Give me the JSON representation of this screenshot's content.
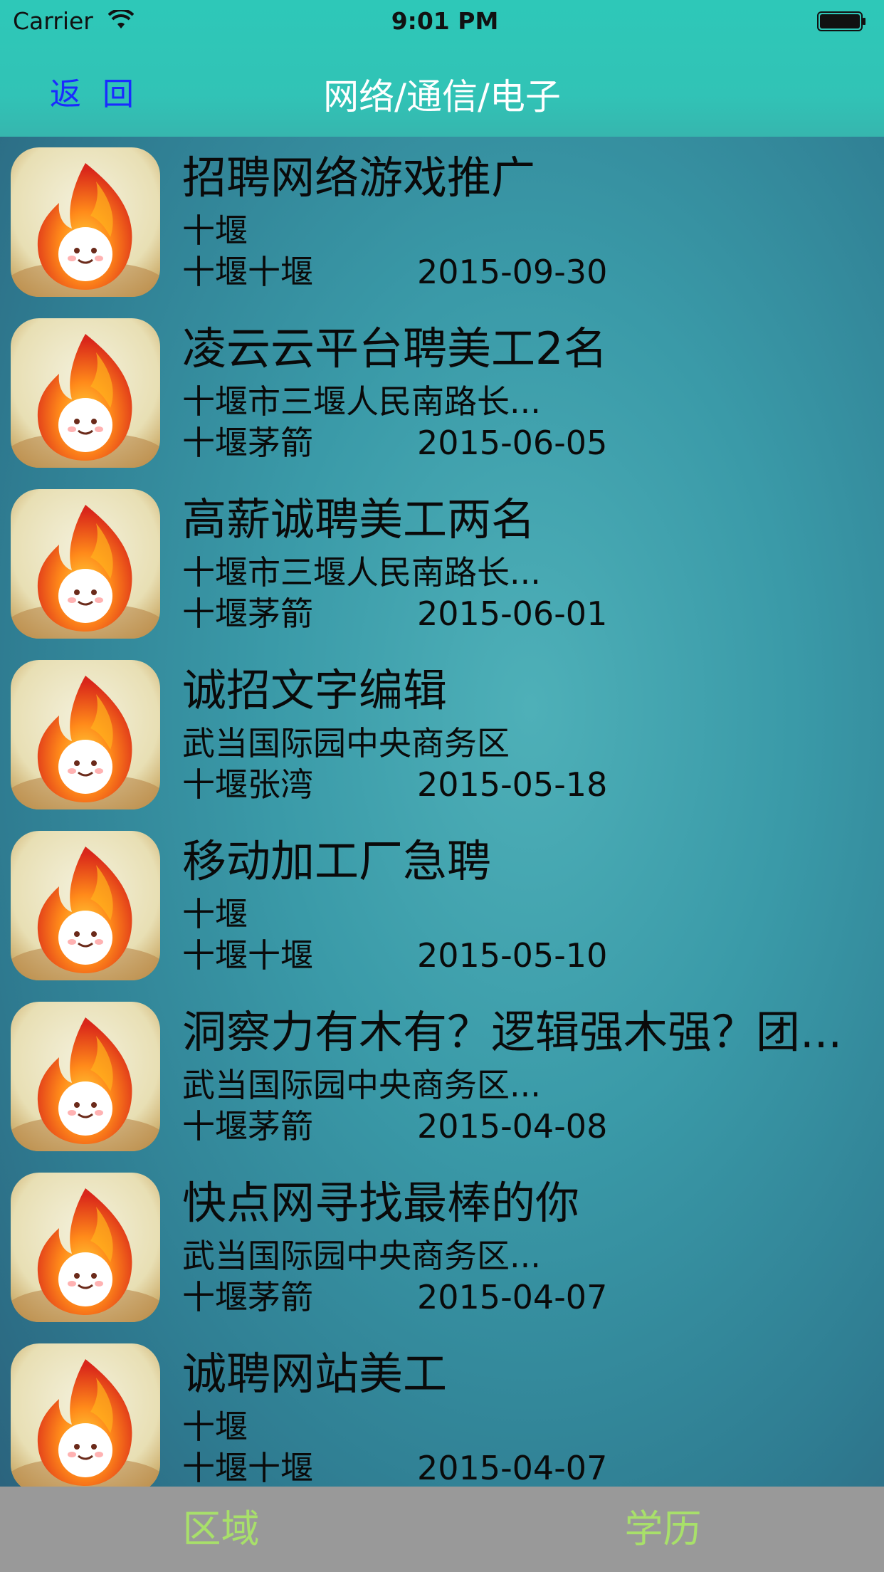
{
  "status_bar": {
    "carrier": "Carrier",
    "time": "9:01 PM"
  },
  "nav": {
    "back_label": "返 回",
    "title": "网络/通信/电子"
  },
  "jobs": [
    {
      "title": "招聘网络游戏推广",
      "address": "十堰",
      "area": "十堰十堰",
      "date": "2015-09-30"
    },
    {
      "title": "凌云云平台聘美工2名",
      "address": "十堰市三堰人民南路长...",
      "area": "十堰茅箭",
      "date": "2015-06-05"
    },
    {
      "title": "高薪诚聘美工两名",
      "address": "十堰市三堰人民南路长...",
      "area": "十堰茅箭",
      "date": "2015-06-01"
    },
    {
      "title": "诚招文字编辑",
      "address": "武当国际园中央商务区",
      "area": "十堰张湾",
      "date": "2015-05-18"
    },
    {
      "title": "移动加工厂急聘",
      "address": "十堰",
      "area": "十堰十堰",
      "date": "2015-05-10"
    },
    {
      "title": "洞察力有木有？逻辑强木强？团...",
      "address": "武当国际园中央商务区...",
      "area": "十堰茅箭",
      "date": "2015-04-08"
    },
    {
      "title": "快点网寻找最棒的你",
      "address": "武当国际园中央商务区...",
      "area": "十堰茅箭",
      "date": "2015-04-07"
    },
    {
      "title": "诚聘网站美工",
      "address": "十堰",
      "area": "十堰十堰",
      "date": "2015-04-07"
    }
  ],
  "tabs": {
    "left_label": "区域",
    "right_label": "学历"
  },
  "colors": {
    "nav_bar": "#31c3b6",
    "back_link": "#1a2bff",
    "tab_bar": "#999999",
    "tab_text": "#a8e06a"
  },
  "icons": {
    "row_thumbnail": "flame-mascot-icon"
  }
}
